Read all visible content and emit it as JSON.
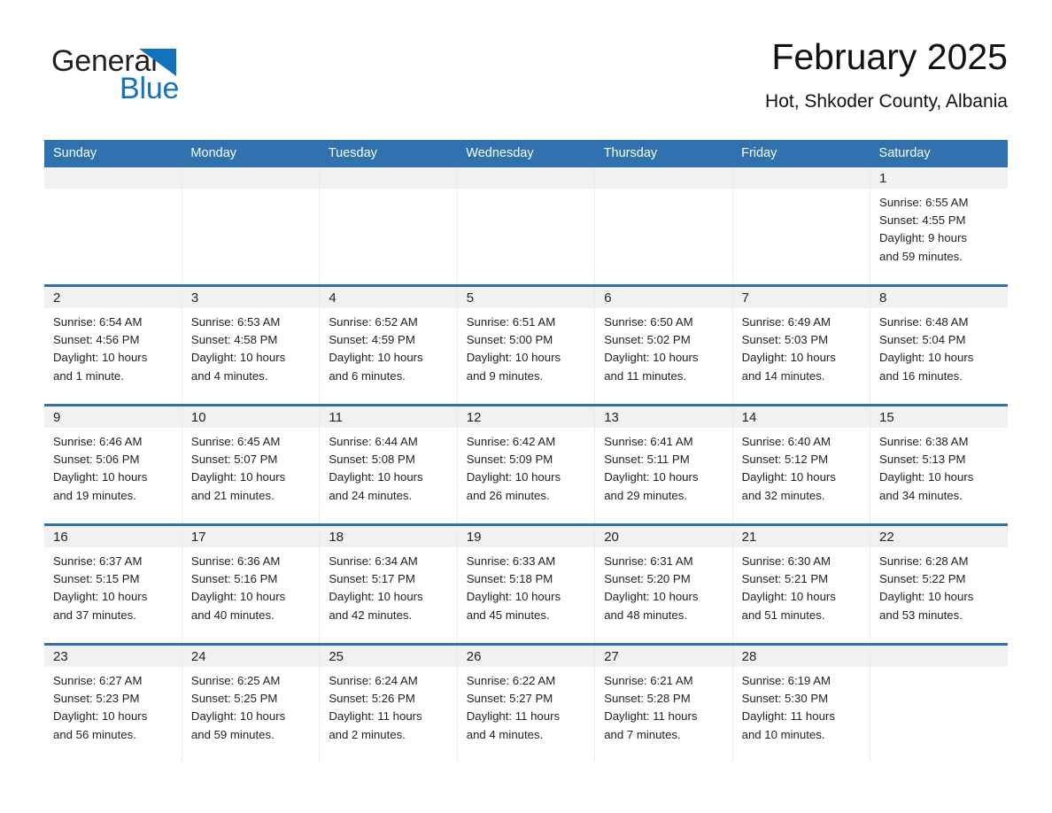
{
  "brand": {
    "name_part1": "General",
    "name_part2": "Blue",
    "flag_color": "#1273ba"
  },
  "header": {
    "month_title": "February 2025",
    "location": "Hot, Shkoder County, Albania"
  },
  "theme": {
    "header_blue": "#3071b0",
    "daynum_band": "#f1f1f1",
    "text": "#222222"
  },
  "weekday_headers": [
    "Sunday",
    "Monday",
    "Tuesday",
    "Wednesday",
    "Thursday",
    "Friday",
    "Saturday"
  ],
  "weeks": [
    [
      {
        "empty": true
      },
      {
        "empty": true
      },
      {
        "empty": true
      },
      {
        "empty": true
      },
      {
        "empty": true
      },
      {
        "empty": true
      },
      {
        "empty": false,
        "day": "1",
        "sunrise": "Sunrise: 6:55 AM",
        "sunset": "Sunset: 4:55 PM",
        "daylight_line1": "Daylight: 9 hours",
        "daylight_line2": "and 59 minutes."
      }
    ],
    [
      {
        "empty": false,
        "day": "2",
        "sunrise": "Sunrise: 6:54 AM",
        "sunset": "Sunset: 4:56 PM",
        "daylight_line1": "Daylight: 10 hours",
        "daylight_line2": "and 1 minute."
      },
      {
        "empty": false,
        "day": "3",
        "sunrise": "Sunrise: 6:53 AM",
        "sunset": "Sunset: 4:58 PM",
        "daylight_line1": "Daylight: 10 hours",
        "daylight_line2": "and 4 minutes."
      },
      {
        "empty": false,
        "day": "4",
        "sunrise": "Sunrise: 6:52 AM",
        "sunset": "Sunset: 4:59 PM",
        "daylight_line1": "Daylight: 10 hours",
        "daylight_line2": "and 6 minutes."
      },
      {
        "empty": false,
        "day": "5",
        "sunrise": "Sunrise: 6:51 AM",
        "sunset": "Sunset: 5:00 PM",
        "daylight_line1": "Daylight: 10 hours",
        "daylight_line2": "and 9 minutes."
      },
      {
        "empty": false,
        "day": "6",
        "sunrise": "Sunrise: 6:50 AM",
        "sunset": "Sunset: 5:02 PM",
        "daylight_line1": "Daylight: 10 hours",
        "daylight_line2": "and 11 minutes."
      },
      {
        "empty": false,
        "day": "7",
        "sunrise": "Sunrise: 6:49 AM",
        "sunset": "Sunset: 5:03 PM",
        "daylight_line1": "Daylight: 10 hours",
        "daylight_line2": "and 14 minutes."
      },
      {
        "empty": false,
        "day": "8",
        "sunrise": "Sunrise: 6:48 AM",
        "sunset": "Sunset: 5:04 PM",
        "daylight_line1": "Daylight: 10 hours",
        "daylight_line2": "and 16 minutes."
      }
    ],
    [
      {
        "empty": false,
        "day": "9",
        "sunrise": "Sunrise: 6:46 AM",
        "sunset": "Sunset: 5:06 PM",
        "daylight_line1": "Daylight: 10 hours",
        "daylight_line2": "and 19 minutes."
      },
      {
        "empty": false,
        "day": "10",
        "sunrise": "Sunrise: 6:45 AM",
        "sunset": "Sunset: 5:07 PM",
        "daylight_line1": "Daylight: 10 hours",
        "daylight_line2": "and 21 minutes."
      },
      {
        "empty": false,
        "day": "11",
        "sunrise": "Sunrise: 6:44 AM",
        "sunset": "Sunset: 5:08 PM",
        "daylight_line1": "Daylight: 10 hours",
        "daylight_line2": "and 24 minutes."
      },
      {
        "empty": false,
        "day": "12",
        "sunrise": "Sunrise: 6:42 AM",
        "sunset": "Sunset: 5:09 PM",
        "daylight_line1": "Daylight: 10 hours",
        "daylight_line2": "and 26 minutes."
      },
      {
        "empty": false,
        "day": "13",
        "sunrise": "Sunrise: 6:41 AM",
        "sunset": "Sunset: 5:11 PM",
        "daylight_line1": "Daylight: 10 hours",
        "daylight_line2": "and 29 minutes."
      },
      {
        "empty": false,
        "day": "14",
        "sunrise": "Sunrise: 6:40 AM",
        "sunset": "Sunset: 5:12 PM",
        "daylight_line1": "Daylight: 10 hours",
        "daylight_line2": "and 32 minutes."
      },
      {
        "empty": false,
        "day": "15",
        "sunrise": "Sunrise: 6:38 AM",
        "sunset": "Sunset: 5:13 PM",
        "daylight_line1": "Daylight: 10 hours",
        "daylight_line2": "and 34 minutes."
      }
    ],
    [
      {
        "empty": false,
        "day": "16",
        "sunrise": "Sunrise: 6:37 AM",
        "sunset": "Sunset: 5:15 PM",
        "daylight_line1": "Daylight: 10 hours",
        "daylight_line2": "and 37 minutes."
      },
      {
        "empty": false,
        "day": "17",
        "sunrise": "Sunrise: 6:36 AM",
        "sunset": "Sunset: 5:16 PM",
        "daylight_line1": "Daylight: 10 hours",
        "daylight_line2": "and 40 minutes."
      },
      {
        "empty": false,
        "day": "18",
        "sunrise": "Sunrise: 6:34 AM",
        "sunset": "Sunset: 5:17 PM",
        "daylight_line1": "Daylight: 10 hours",
        "daylight_line2": "and 42 minutes."
      },
      {
        "empty": false,
        "day": "19",
        "sunrise": "Sunrise: 6:33 AM",
        "sunset": "Sunset: 5:18 PM",
        "daylight_line1": "Daylight: 10 hours",
        "daylight_line2": "and 45 minutes."
      },
      {
        "empty": false,
        "day": "20",
        "sunrise": "Sunrise: 6:31 AM",
        "sunset": "Sunset: 5:20 PM",
        "daylight_line1": "Daylight: 10 hours",
        "daylight_line2": "and 48 minutes."
      },
      {
        "empty": false,
        "day": "21",
        "sunrise": "Sunrise: 6:30 AM",
        "sunset": "Sunset: 5:21 PM",
        "daylight_line1": "Daylight: 10 hours",
        "daylight_line2": "and 51 minutes."
      },
      {
        "empty": false,
        "day": "22",
        "sunrise": "Sunrise: 6:28 AM",
        "sunset": "Sunset: 5:22 PM",
        "daylight_line1": "Daylight: 10 hours",
        "daylight_line2": "and 53 minutes."
      }
    ],
    [
      {
        "empty": false,
        "day": "23",
        "sunrise": "Sunrise: 6:27 AM",
        "sunset": "Sunset: 5:23 PM",
        "daylight_line1": "Daylight: 10 hours",
        "daylight_line2": "and 56 minutes."
      },
      {
        "empty": false,
        "day": "24",
        "sunrise": "Sunrise: 6:25 AM",
        "sunset": "Sunset: 5:25 PM",
        "daylight_line1": "Daylight: 10 hours",
        "daylight_line2": "and 59 minutes."
      },
      {
        "empty": false,
        "day": "25",
        "sunrise": "Sunrise: 6:24 AM",
        "sunset": "Sunset: 5:26 PM",
        "daylight_line1": "Daylight: 11 hours",
        "daylight_line2": "and 2 minutes."
      },
      {
        "empty": false,
        "day": "26",
        "sunrise": "Sunrise: 6:22 AM",
        "sunset": "Sunset: 5:27 PM",
        "daylight_line1": "Daylight: 11 hours",
        "daylight_line2": "and 4 minutes."
      },
      {
        "empty": false,
        "day": "27",
        "sunrise": "Sunrise: 6:21 AM",
        "sunset": "Sunset: 5:28 PM",
        "daylight_line1": "Daylight: 11 hours",
        "daylight_line2": "and 7 minutes."
      },
      {
        "empty": false,
        "day": "28",
        "sunrise": "Sunrise: 6:19 AM",
        "sunset": "Sunset: 5:30 PM",
        "daylight_line1": "Daylight: 11 hours",
        "daylight_line2": "and 10 minutes."
      },
      {
        "empty": true
      }
    ]
  ]
}
